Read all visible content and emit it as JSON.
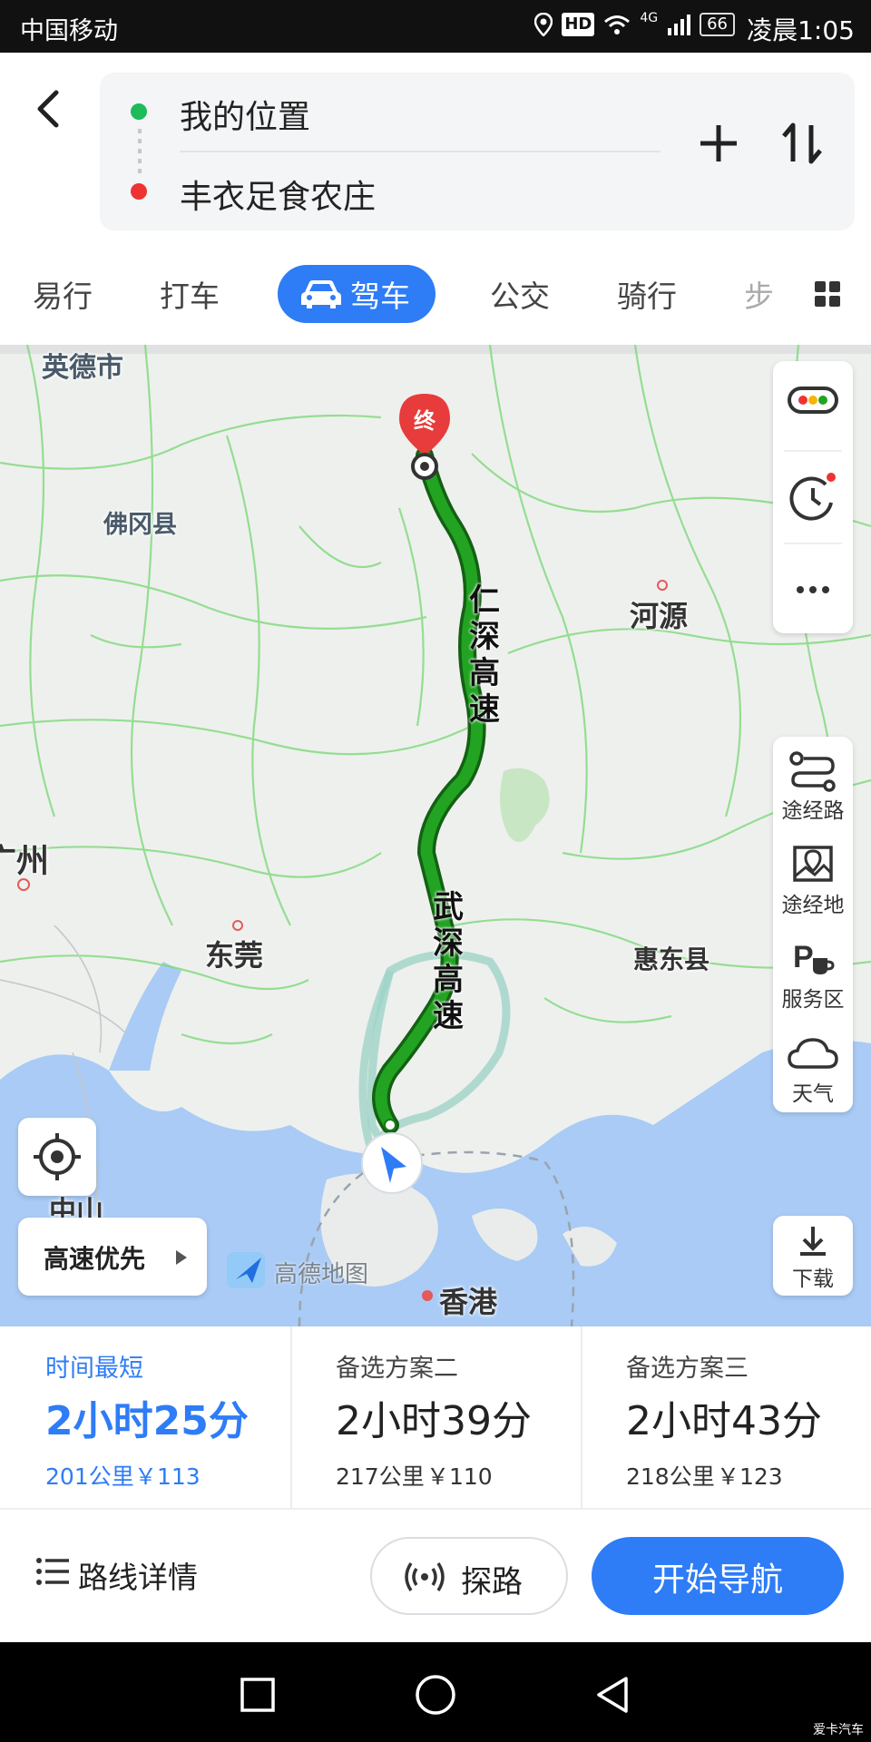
{
  "status_bar": {
    "carrier": "中国移动",
    "icons": [
      "location-icon",
      "hd-icon",
      "wifi-icon",
      "4g-signal-icon"
    ],
    "hd": "HD",
    "network": "4G",
    "battery": "66",
    "time": "凌晨1:05"
  },
  "route": {
    "origin": "我的位置",
    "destination": "丰衣足食农庄",
    "origin_color": "#1dbb5a",
    "destination_color": "#ee3333"
  },
  "tabs": [
    {
      "label": "易行"
    },
    {
      "label": "打车"
    },
    {
      "label": "驾车"
    },
    {
      "label": "公交"
    },
    {
      "label": "骑行"
    },
    {
      "label": "步"
    }
  ],
  "accent_color": "#2e7cf6",
  "map": {
    "places": [
      "英德市",
      "佛冈县",
      "河源",
      "广州",
      "东莞",
      "惠东县",
      "中山",
      "香港"
    ],
    "end_marker": "终",
    "road_labels": [
      "仁深高速",
      "武深高速"
    ],
    "logo": "高德地图",
    "right_tools": [
      "途经路",
      "途经地",
      "服务区",
      "天气"
    ],
    "download": "下载",
    "preference": "高速优先"
  },
  "options": [
    {
      "label": "时间最短",
      "duration": "2小时25分",
      "distance": "201公里",
      "cost": "￥113",
      "selected": true
    },
    {
      "label": "备选方案二",
      "duration": "2小时39分",
      "distance": "217公里",
      "cost": "￥110",
      "selected": false
    },
    {
      "label": "备选方案三",
      "duration": "2小时43分",
      "distance": "218公里",
      "cost": "￥123",
      "selected": false
    }
  ],
  "actions": {
    "details": "路线详情",
    "explore": "探路",
    "start": "开始导航"
  },
  "watermark": "爱卡汽车"
}
